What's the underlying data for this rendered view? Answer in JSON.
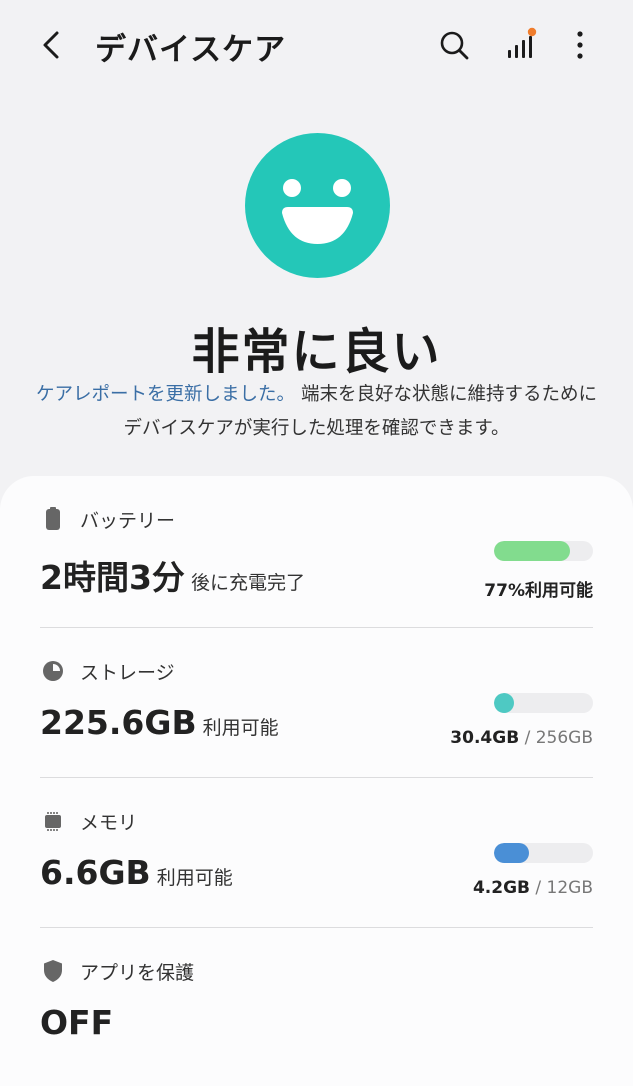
{
  "header": {
    "title": "デバイスケア"
  },
  "status": {
    "title": "非常に良い",
    "link_text": "ケアレポートを更新しました。",
    "description": " 端末を良好な状態に維持するためにデバイスケアが実行した処理を確認できます。"
  },
  "battery": {
    "label": "バッテリー",
    "big_value": "2時間3分",
    "suffix": "後に充電完了",
    "percent_text": "77%利用可能",
    "level_percent": 77,
    "bar_color": "#82dc8e"
  },
  "storage": {
    "label": "ストレージ",
    "big_value": "225.6GB",
    "suffix": "利用可能",
    "used": "30.4GB",
    "separator": "/",
    "total": "256GB",
    "used_fraction": 0.119,
    "bar_color": "#4ec9c3"
  },
  "memory": {
    "label": "メモリ",
    "big_value": "6.6GB",
    "suffix": "利用可能",
    "used": "4.2GB",
    "separator": "/",
    "total": "12GB",
    "used_fraction": 0.35,
    "bar_color": "#4a8fd6"
  },
  "app_protection": {
    "label": "アプリを保護",
    "value": "OFF"
  },
  "colors": {
    "accent_teal": "#24c7b8",
    "notification_dot": "#f07d2c",
    "link_blue": "#3a6ea5"
  },
  "icons": {
    "back": "back-arrow-icon",
    "search": "search-icon",
    "stats": "bar-chart-icon",
    "more": "more-vertical-icon",
    "status": "smiley-face-icon",
    "battery": "battery-icon",
    "storage": "pie-chart-icon",
    "memory": "memory-chip-icon",
    "shield": "shield-icon"
  }
}
